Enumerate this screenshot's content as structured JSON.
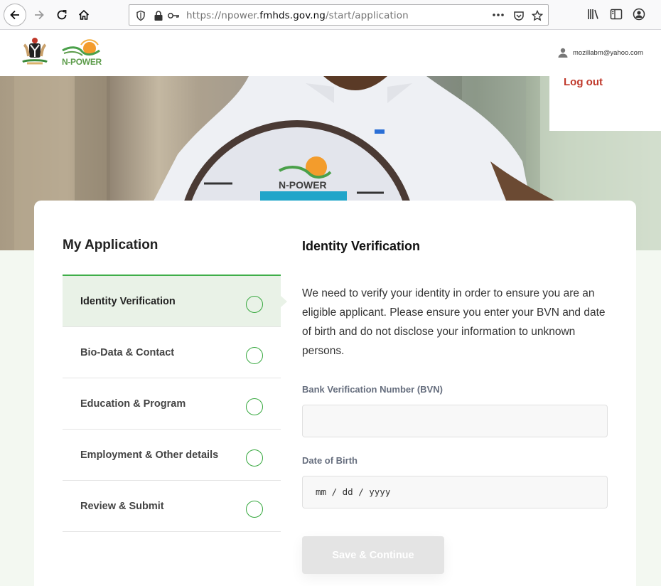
{
  "browser": {
    "url_prefix": "https://npower.",
    "url_host": "fmhds.gov.ng",
    "url_path": "/start/application"
  },
  "header": {
    "logo_text": "N-POWER",
    "user_email": "mozillabm@yahoo.com",
    "logout_label": "Log out"
  },
  "hero": {
    "sign_text": "N-POWER"
  },
  "sidebar": {
    "title": "My Application",
    "steps": [
      {
        "label": "Identity Verification",
        "active": true
      },
      {
        "label": "Bio-Data & Contact",
        "active": false
      },
      {
        "label": "Education & Program",
        "active": false
      },
      {
        "label": "Employment & Other details",
        "active": false
      },
      {
        "label": "Review & Submit",
        "active": false
      }
    ]
  },
  "main": {
    "title": "Identity Verification",
    "description": "We need to verify your identity in order to ensure you are an eligible applicant. Please ensure you enter your BVN and date of birth and do not disclose your information to unknown persons.",
    "bvn_label": "Bank Verification Number (BVN)",
    "bvn_value": "",
    "dob_label": "Date of Birth",
    "dob_placeholder": "mm / dd / yyyy",
    "submit_label": "Save & Continue"
  },
  "colors": {
    "accent_green": "#3fae49",
    "logout_red": "#c0392b",
    "active_step_bg": "#e9f2e7"
  }
}
